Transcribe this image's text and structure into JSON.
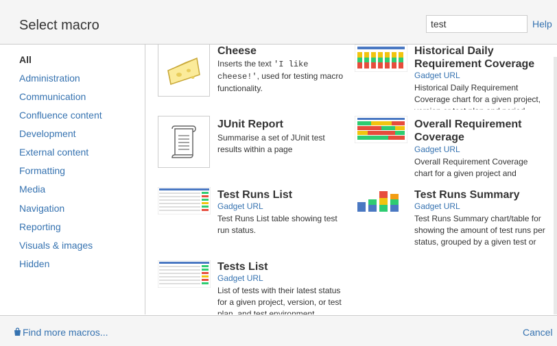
{
  "dialog": {
    "title": "Select macro",
    "search_value": "test",
    "help_label": "Help"
  },
  "sidebar": {
    "categories": [
      "All",
      "Administration",
      "Communication",
      "Confluence content",
      "Development",
      "External content",
      "Formatting",
      "Media",
      "Navigation",
      "Reporting",
      "Visuals & images",
      "Hidden"
    ],
    "active": "All"
  },
  "macros": [
    {
      "name": "Cheese",
      "desc_prefix": "Inserts the text ",
      "desc_code": "'I like cheese!'",
      "desc_suffix": ", used for testing macro functionality.",
      "icon": "cheese-icon"
    },
    {
      "name": "Historical Daily Requirement Coverage",
      "gadget": "Gadget URL",
      "desc": "Historical Daily Requirement Coverage chart for a given project, version or test plan and period.",
      "icon": "bar-chart-thumbnail"
    },
    {
      "name": "JUnit Report",
      "desc": "Summarise a set of JUnit test results within a page",
      "icon": "scroll-icon"
    },
    {
      "name": "Overall Requirement Coverage",
      "gadget": "Gadget URL",
      "desc": "Overall Requirement Coverage chart for a given project and version or test plan.",
      "icon": "heatmap-thumbnail"
    },
    {
      "name": "Test Runs List",
      "gadget": "Gadget URL",
      "desc": "Test Runs List table showing test run status.",
      "icon": "table-thumbnail"
    },
    {
      "name": "Test Runs Summary",
      "gadget": "Gadget URL",
      "desc": "Test Runs Summary chart/table for showing the amount of test runs per status, grouped by a given test or test run field.",
      "icon": "stacked-bar-thumbnail"
    },
    {
      "name": "Tests List",
      "gadget": "Gadget URL",
      "desc": "List of tests with their latest status for a given project, version, or test plan, and test environment.",
      "icon": "table-thumbnail"
    }
  ],
  "footer": {
    "find_more": "Find more macros...",
    "cancel": "Cancel"
  },
  "colors": {
    "link": "#3572b0",
    "header_bg": "#f5f5f5",
    "border": "#cccccc"
  }
}
